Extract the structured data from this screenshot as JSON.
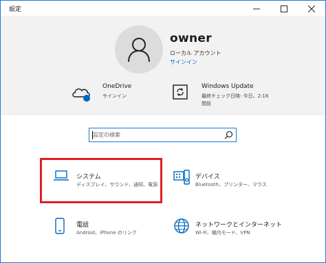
{
  "window": {
    "title": "設定",
    "minimize_glyph": "–",
    "maximize_glyph": "☐",
    "close_glyph": "✕"
  },
  "account": {
    "name": "owner",
    "type": "ローカル アカウント",
    "signin_link": "サインイン"
  },
  "status_items": [
    {
      "icon": "onedrive-cloud-icon",
      "title": "OneDrive",
      "sub": "サインイン"
    },
    {
      "icon": "windows-update-icon",
      "title": "Windows Update",
      "sub1": "最終チェック日時: 今日、2:16",
      "sub2": "間前"
    }
  ],
  "search": {
    "placeholder": "設定の検索"
  },
  "categories": [
    {
      "icon": "laptop-icon",
      "title": "システム",
      "sub": "ディスプレイ、サウンド、通知、電源"
    },
    {
      "icon": "devices-icon",
      "title": "デバイス",
      "sub": "Bluetooth、プリンター、マウス"
    },
    {
      "icon": "phone-icon",
      "title": "電話",
      "sub": "Android、iPhone のリンク"
    },
    {
      "icon": "globe-icon",
      "title": "ネットワークとインターネット",
      "sub": "Wi-Fi、機内モード、VPN"
    }
  ],
  "colors": {
    "accent": "#0067c0",
    "highlight": "#e01e1e",
    "header_bg": "#f2f2f2"
  }
}
